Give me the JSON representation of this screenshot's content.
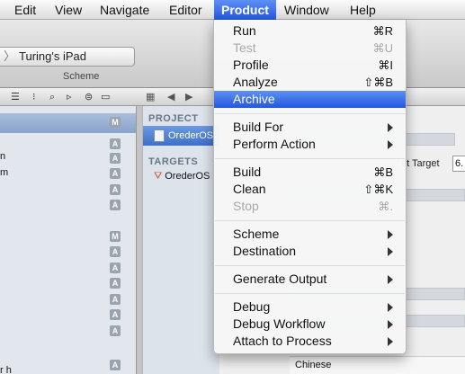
{
  "menubar": {
    "items": [
      {
        "label": "Edit"
      },
      {
        "label": "View"
      },
      {
        "label": "Navigate"
      },
      {
        "label": "Editor"
      },
      {
        "label": "Product"
      },
      {
        "label": "Window"
      },
      {
        "label": "Help"
      }
    ],
    "active_index": 4
  },
  "toolbar": {
    "scheme_destination": "Turing's iPad",
    "scheme_label": "Scheme"
  },
  "navigator": {
    "badges": [
      "M",
      "A",
      "A",
      "A",
      "A",
      "A",
      "M",
      "A",
      "A",
      "A",
      "A",
      "A",
      "A",
      "A"
    ],
    "fragments": [
      "n",
      "m",
      "r h"
    ]
  },
  "project_panel": {
    "project_header": "PROJECT",
    "project_item": "OrederOS",
    "targets_header": "TARGETS",
    "target_item": "OrederOS"
  },
  "content": {
    "deployment_label": "nt Target",
    "deployment_value": "6.",
    "language_row": "Chinese"
  },
  "product_menu": {
    "items": [
      {
        "label": "Run",
        "shortcut": "⌘R",
        "enabled": true
      },
      {
        "label": "Test",
        "shortcut": "⌘U",
        "enabled": false
      },
      {
        "label": "Profile",
        "shortcut": "⌘I",
        "enabled": true
      },
      {
        "label": "Analyze",
        "shortcut": "⇧⌘B",
        "enabled": true
      },
      {
        "label": "Archive",
        "shortcut": "",
        "enabled": true,
        "highlighted": true
      },
      {
        "label": "Build For",
        "submenu": true,
        "enabled": true
      },
      {
        "label": "Perform Action",
        "submenu": true,
        "enabled": true
      },
      {
        "label": "Build",
        "shortcut": "⌘B",
        "enabled": true
      },
      {
        "label": "Clean",
        "shortcut": "⇧⌘K",
        "enabled": true
      },
      {
        "label": "Stop",
        "shortcut": "⌘.",
        "enabled": false
      },
      {
        "label": "Scheme",
        "submenu": true,
        "enabled": true
      },
      {
        "label": "Destination",
        "submenu": true,
        "enabled": true
      },
      {
        "label": "Generate Output",
        "submenu": true,
        "enabled": true
      },
      {
        "label": "Debug",
        "submenu": true,
        "enabled": true
      },
      {
        "label": "Debug Workflow",
        "submenu": true,
        "enabled": true
      },
      {
        "label": "Attach to Process",
        "submenu": true,
        "enabled": true
      }
    ]
  },
  "colors": {
    "highlight": "#2f62e6",
    "menubar_bg": "#e9e9e9",
    "disabled_text": "#a9a9a9",
    "navigator_bg": "#e2e7ee",
    "badge_bg": "#9aa3ae"
  }
}
